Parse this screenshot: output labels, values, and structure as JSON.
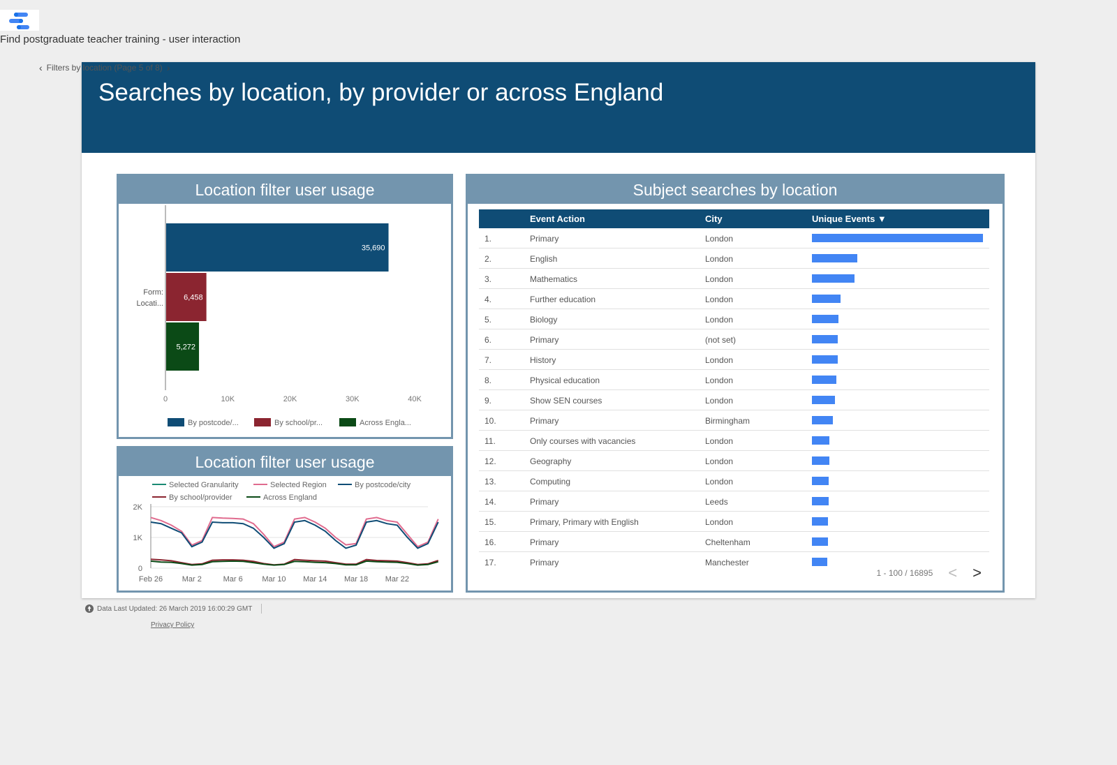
{
  "app": {
    "title": "Find postgraduate teacher training - user interaction"
  },
  "page_nav": {
    "label": "Filters by location (Page 5 of 8)"
  },
  "report": {
    "title": "Searches by location, by provider or across England"
  },
  "bar_chart": {
    "title": "Location filter user usage"
  },
  "line_chart": {
    "title": "Location filter user usage"
  },
  "table": {
    "title": "Subject searches by location",
    "columns": [
      "Event Action",
      "City",
      "Unique Events"
    ],
    "sort_arrow": "▼",
    "rows": [
      {
        "idx": "1.",
        "action": "Primary",
        "city": "London",
        "bar": 1.0
      },
      {
        "idx": "2.",
        "action": "English",
        "city": "London",
        "bar": 0.266
      },
      {
        "idx": "3.",
        "action": "Mathematics",
        "city": "London",
        "bar": 0.25
      },
      {
        "idx": "4.",
        "action": "Further education",
        "city": "London",
        "bar": 0.168
      },
      {
        "idx": "5.",
        "action": "Biology",
        "city": "London",
        "bar": 0.156
      },
      {
        "idx": "6.",
        "action": "Primary",
        "city": "(not set)",
        "bar": 0.152
      },
      {
        "idx": "7.",
        "action": "History",
        "city": "London",
        "bar": 0.152
      },
      {
        "idx": "8.",
        "action": "Physical education",
        "city": "London",
        "bar": 0.144
      },
      {
        "idx": "9.",
        "action": "Show SEN courses",
        "city": "London",
        "bar": 0.136
      },
      {
        "idx": "10.",
        "action": "Primary",
        "city": "Birmingham",
        "bar": 0.123
      },
      {
        "idx": "11.",
        "action": "Only courses with vacancies",
        "city": "London",
        "bar": 0.103
      },
      {
        "idx": "12.",
        "action": "Geography",
        "city": "London",
        "bar": 0.103
      },
      {
        "idx": "13.",
        "action": "Computing",
        "city": "London",
        "bar": 0.099
      },
      {
        "idx": "14.",
        "action": "Primary",
        "city": "Leeds",
        "bar": 0.099
      },
      {
        "idx": "15.",
        "action": "Primary, Primary with English",
        "city": "London",
        "bar": 0.095
      },
      {
        "idx": "16.",
        "action": "Primary",
        "city": "Cheltenham",
        "bar": 0.095
      },
      {
        "idx": "17.",
        "action": "Primary",
        "city": "Manchester",
        "bar": 0.091
      }
    ],
    "pager": {
      "range": "1 - 100 / 16895",
      "prev": "<",
      "next": ">"
    }
  },
  "footer": {
    "updated": "Data Last Updated: 26 March 2019 16:00:29 GMT",
    "privacy": "Privacy Policy"
  },
  "colors": {
    "navy": "#0f4c75",
    "panel": "#7395ae",
    "bar_blue": "#4285f4"
  },
  "chart_data": [
    {
      "type": "bar",
      "orientation": "horizontal",
      "category_label": "Form: Locati...",
      "series": [
        {
          "name": "By postcode/...",
          "value": 35690,
          "label": "35,690",
          "color": "#0f4c75"
        },
        {
          "name": "By school/pr...",
          "value": 6458,
          "label": "6,458",
          "color": "#8b2530"
        },
        {
          "name": "Across Engla...",
          "value": 5272,
          "label": "5,272",
          "color": "#0b4a16"
        }
      ],
      "xlim": [
        0,
        40000
      ],
      "xticks": [
        0,
        10000,
        20000,
        30000,
        40000
      ],
      "xtick_labels": [
        "0",
        "10K",
        "20K",
        "30K",
        "40K"
      ],
      "legend": "bottom"
    },
    {
      "type": "line",
      "x": [
        "Feb 26",
        "Feb 27",
        "Feb 28",
        "Mar 1",
        "Mar 2",
        "Mar 3",
        "Mar 4",
        "Mar 5",
        "Mar 6",
        "Mar 7",
        "Mar 8",
        "Mar 9",
        "Mar 10",
        "Mar 11",
        "Mar 12",
        "Mar 13",
        "Mar 14",
        "Mar 15",
        "Mar 16",
        "Mar 17",
        "Mar 18",
        "Mar 19",
        "Mar 20",
        "Mar 21",
        "Mar 22",
        "Mar 23",
        "Mar 24",
        "Mar 25"
      ],
      "xtick_labels": [
        "Feb 26",
        "Mar 2",
        "Mar 6",
        "Mar 10",
        "Mar 14",
        "Mar 18",
        "Mar 22"
      ],
      "ylim": [
        0,
        2000
      ],
      "yticks": [
        0,
        1000,
        2000
      ],
      "ytick_labels": [
        "0",
        "1K",
        "2K"
      ],
      "legend": "top",
      "series": [
        {
          "name": "Selected Granularity",
          "color": "#1a8a73",
          "values": []
        },
        {
          "name": "Selected Region",
          "color": "#e06b8e",
          "values": [
            1650,
            1550,
            1400,
            1200,
            750,
            900,
            1650,
            1630,
            1620,
            1600,
            1450,
            1100,
            700,
            850,
            1600,
            1650,
            1500,
            1300,
            1000,
            760,
            800,
            1600,
            1650,
            1550,
            1500,
            1100,
            700,
            850,
            1600
          ]
        },
        {
          "name": "By postcode/city",
          "color": "#0f4c75",
          "values": [
            1500,
            1450,
            1300,
            1150,
            700,
            850,
            1500,
            1480,
            1480,
            1450,
            1300,
            1000,
            650,
            800,
            1500,
            1550,
            1400,
            1200,
            900,
            650,
            750,
            1500,
            1550,
            1450,
            1400,
            1000,
            650,
            800,
            1500
          ]
        },
        {
          "name": "By school/provider",
          "color": "#8b2530",
          "values": [
            290,
            270,
            240,
            180,
            120,
            140,
            260,
            270,
            270,
            260,
            220,
            150,
            110,
            130,
            280,
            260,
            240,
            230,
            180,
            130,
            130,
            280,
            250,
            240,
            230,
            180,
            120,
            140,
            250
          ]
        },
        {
          "name": "Across England",
          "color": "#0b4a16",
          "values": [
            230,
            200,
            190,
            150,
            100,
            120,
            210,
            220,
            230,
            220,
            180,
            130,
            100,
            120,
            220,
            210,
            190,
            180,
            150,
            110,
            110,
            230,
            210,
            200,
            190,
            150,
            100,
            120,
            210
          ]
        }
      ]
    }
  ]
}
